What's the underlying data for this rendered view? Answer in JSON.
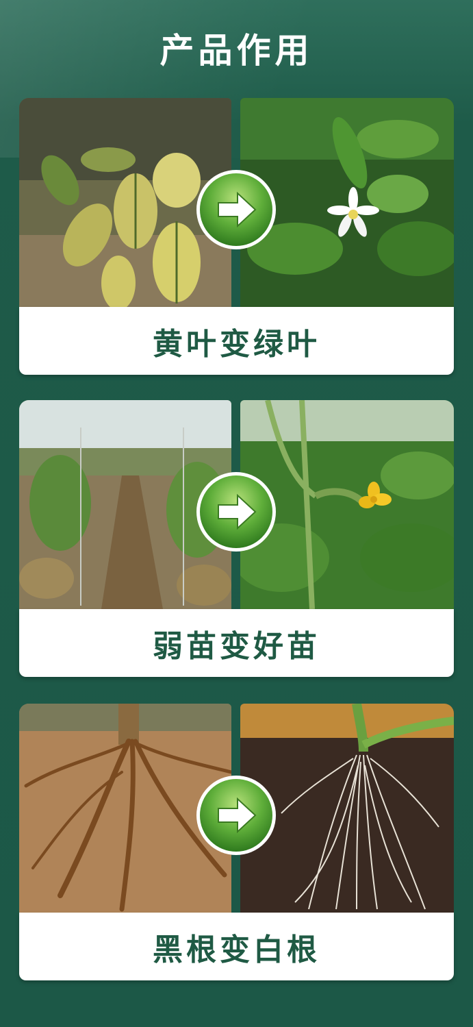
{
  "title": "产品作用",
  "cards": [
    {
      "caption": "黄叶变绿叶"
    },
    {
      "caption": "弱苗变好苗"
    },
    {
      "caption": "黑根变白根"
    }
  ],
  "icons": {
    "transition": "right-arrow-icon"
  },
  "colors": {
    "background": "#1f5e4c",
    "caption_text": "#1f5a44",
    "button_green": "#5fae3a"
  }
}
